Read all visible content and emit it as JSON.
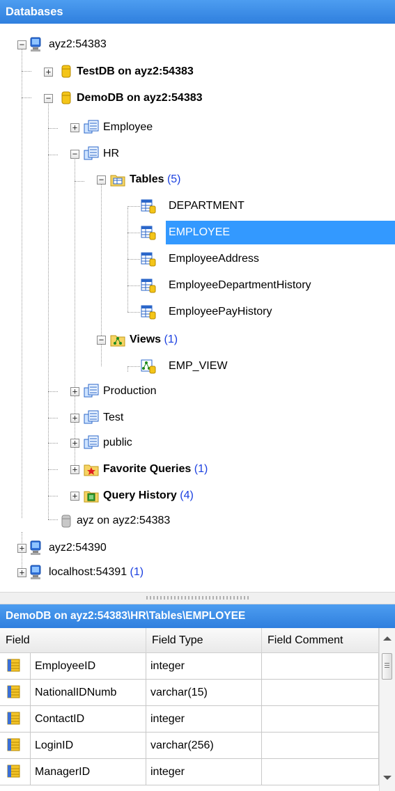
{
  "panel": {
    "title": "Databases"
  },
  "tree": {
    "host1": "ayz2:54383",
    "testdb": "TestDB on ayz2:54383",
    "demodb": "DemoDB on ayz2:54383",
    "employee_schema": "Employee",
    "hr": "HR",
    "tables": {
      "label": "Tables",
      "count": "(5)"
    },
    "table_items": [
      "DEPARTMENT",
      "EMPLOYEE",
      "EmployeeAddress",
      "EmployeeDepartmentHistory",
      "EmployeePayHistory"
    ],
    "views": {
      "label": "Views",
      "count": "(1)"
    },
    "view_items": [
      "EMP_VIEW"
    ],
    "production": "Production",
    "test": "Test",
    "public": "public",
    "favorite_queries": {
      "label": "Favorite Queries",
      "count": "(1)"
    },
    "query_history": {
      "label": "Query History",
      "count": "(4)"
    },
    "ayz": "ayz on ayz2:54383",
    "host2": "ayz2:54390",
    "host3": {
      "label": "localhost:54391",
      "count": "(1)"
    }
  },
  "path_bar": {
    "text": "DemoDB on ayz2:54383\\HR\\Tables\\EMPLOYEE"
  },
  "grid": {
    "columns": [
      "Field",
      "Field Type",
      "Field Comment"
    ],
    "rows": [
      {
        "field": "EmployeeID",
        "type": "integer",
        "comment": ""
      },
      {
        "field": "NationalIDNumb",
        "type": "varchar(15)",
        "comment": ""
      },
      {
        "field": "ContactID",
        "type": "integer",
        "comment": ""
      },
      {
        "field": "LoginID",
        "type": "varchar(256)",
        "comment": ""
      },
      {
        "field": "ManagerID",
        "type": "integer",
        "comment": ""
      }
    ]
  },
  "colors": {
    "header": "#2f7fde",
    "selection": "#3399ff",
    "count": "#1a3fe0"
  }
}
